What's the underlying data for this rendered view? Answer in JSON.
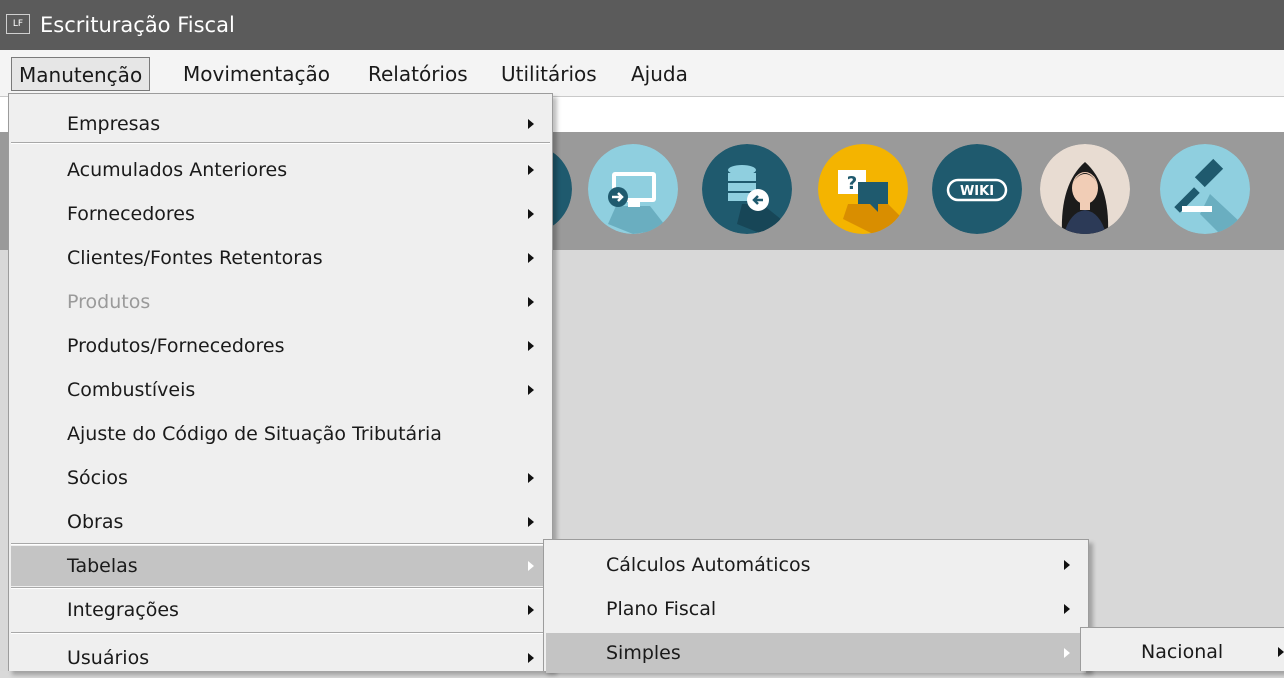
{
  "window": {
    "logo": "LF",
    "title": "Escrituração Fiscal"
  },
  "menubar": [
    {
      "label": "Manutenção"
    },
    {
      "label": "Movimentação"
    },
    {
      "label": "Relatórios"
    },
    {
      "label": "Utilitários"
    },
    {
      "label": "Ajuda"
    }
  ],
  "toolbar": {
    "buttons": [
      {
        "icon": "remote-desktop-icon"
      },
      {
        "icon": "database-restore-icon"
      },
      {
        "icon": "help-chat-icon"
      },
      {
        "icon": "wiki-icon"
      },
      {
        "icon": "assistant-avatar-icon"
      },
      {
        "icon": "gavel-icon"
      }
    ],
    "wiki_label": "WIKI",
    "help_mark": "?"
  },
  "menu_main": [
    {
      "label": "Empresas",
      "submenu": true
    },
    {
      "label": "Acumulados Anteriores",
      "submenu": true
    },
    {
      "label": "Fornecedores",
      "submenu": true
    },
    {
      "label": "Clientes/Fontes Retentoras",
      "submenu": true
    },
    {
      "label": "Produtos",
      "submenu": true,
      "disabled": true
    },
    {
      "label": "Produtos/Fornecedores",
      "submenu": true
    },
    {
      "label": "Combustíveis",
      "submenu": true
    },
    {
      "label": "Ajuste do Código de Situação Tributária",
      "submenu": false
    },
    {
      "label": "Sócios",
      "submenu": true
    },
    {
      "label": "Obras",
      "submenu": true
    },
    {
      "label": "Tabelas",
      "submenu": true,
      "highlighted": true
    },
    {
      "label": "Integrações",
      "submenu": true
    },
    {
      "label": "Usuários",
      "submenu": true
    }
  ],
  "menu_tabelas": [
    {
      "label": "Cálculos Automáticos",
      "submenu": true
    },
    {
      "label": "Plano Fiscal",
      "submenu": true
    },
    {
      "label": "Simples",
      "submenu": true,
      "highlighted": true
    }
  ],
  "menu_simples": [
    {
      "label": "Nacional",
      "submenu": true
    }
  ],
  "colors": {
    "titlebar": "#5b5b5b",
    "toolbar": "#9a9a9a",
    "icon_dark_teal": "#1f5a6e",
    "icon_light_teal": "#8fcfdf",
    "icon_yellow": "#f4b400",
    "menu_highlight": "#c4c4c4"
  }
}
